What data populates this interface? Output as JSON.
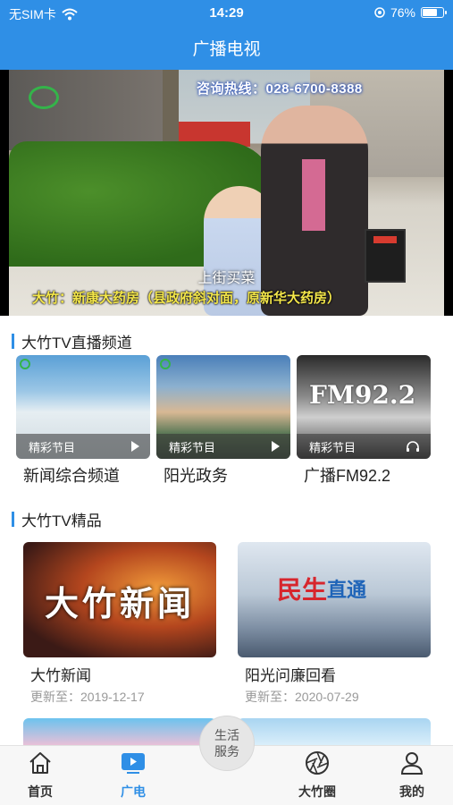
{
  "status_bar": {
    "carrier": "无SIM卡",
    "time": "14:29",
    "battery": "76%",
    "battery_level": 0.76
  },
  "header": {
    "title": "广播电视"
  },
  "video": {
    "hotline": "咨询热线：028-6700-8388",
    "caption_line1": "上街买菜",
    "caption_line2": "大竹：新康大药房（县政府斜对面，原新华大药房）"
  },
  "live_section": {
    "title": "大竹TV直播频道",
    "channels": [
      {
        "overlay": "精彩节目",
        "name": "新闻综合频道",
        "icon": "play-icon"
      },
      {
        "overlay": "精彩节目",
        "name": "阳光政务",
        "icon": "play-icon"
      },
      {
        "overlay": "精彩节目",
        "name": "广播FM92.2",
        "thumb_text": "FM92.2",
        "icon": "headphones-icon"
      }
    ]
  },
  "premium_section": {
    "title": "大竹TV精品",
    "programs": [
      {
        "thumb_text": "大竹新闻",
        "title": "大竹新闻",
        "updated": "更新至：2019-12-17"
      },
      {
        "thumb_text": "民生",
        "thumb_text2": "直通",
        "title": "阳光问廉回看",
        "updated": "更新至：2020-07-29"
      }
    ]
  },
  "tabbar": {
    "home": "首页",
    "broadcast": "广电",
    "life_service_line1": "生活",
    "life_service_line2": "服务",
    "circle": "大竹圈",
    "mine": "我的"
  },
  "colors": {
    "accent": "#2f8fe6"
  }
}
